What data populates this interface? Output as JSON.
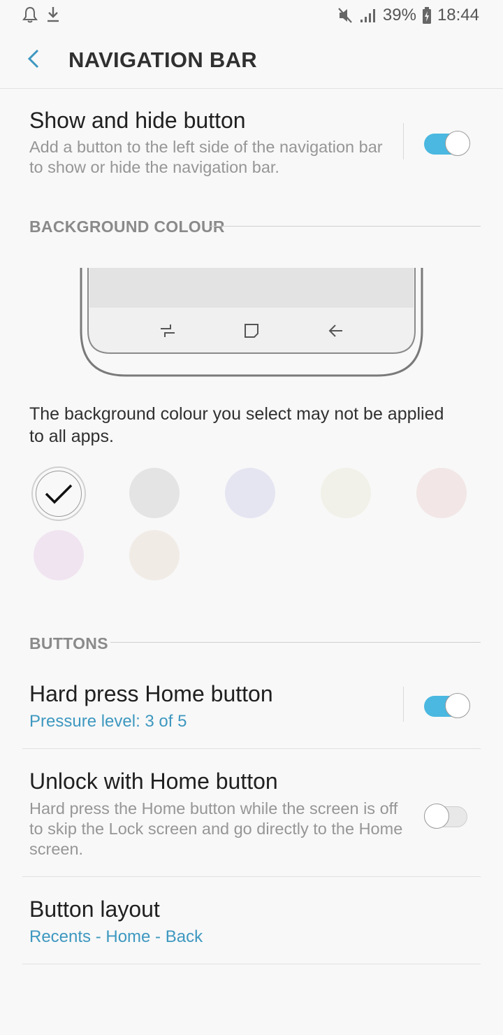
{
  "status_bar": {
    "left_icons": [
      "notification-bell-icon",
      "download-icon"
    ],
    "right_icons": [
      "mute-icon",
      "signal-icon",
      "battery-charging-icon"
    ],
    "battery": "39%",
    "time": "18:44"
  },
  "app_bar": {
    "back_icon": "back-arrow-icon",
    "title": "NAVIGATION BAR"
  },
  "show_hide": {
    "title": "Show and hide button",
    "description": "Add a button to the left side of the navigation bar to show or hide the navigation bar.",
    "enabled": true
  },
  "background_colour": {
    "header": "BACKGROUND COLOUR",
    "note": "The background colour you select may not be applied to all apps.",
    "preview_icons": [
      "recents-icon",
      "home-icon",
      "back-icon"
    ],
    "swatches": [
      {
        "color": "#f8f8f8",
        "selected": true
      },
      {
        "color": "#e4e4e4",
        "selected": false
      },
      {
        "color": "#e5e5f2",
        "selected": false
      },
      {
        "color": "#f1f1e9",
        "selected": false
      },
      {
        "color": "#f2e6e6",
        "selected": false
      },
      {
        "color": "#f0e4f0",
        "selected": false
      },
      {
        "color": "#f1ebe6",
        "selected": false
      }
    ]
  },
  "buttons": {
    "header": "BUTTONS",
    "hard_press": {
      "title": "Hard press Home button",
      "subtitle": "Pressure level: 3 of 5",
      "enabled": true
    },
    "unlock": {
      "title": "Unlock with Home button",
      "description": "Hard press the Home button while the screen is off to skip the Lock screen and go directly to the Home screen.",
      "enabled": false
    },
    "layout": {
      "title": "Button layout",
      "subtitle": "Recents - Home - Back"
    }
  },
  "colors": {
    "accent": "#3e98c0",
    "switch_on": "#4ab8e0"
  }
}
